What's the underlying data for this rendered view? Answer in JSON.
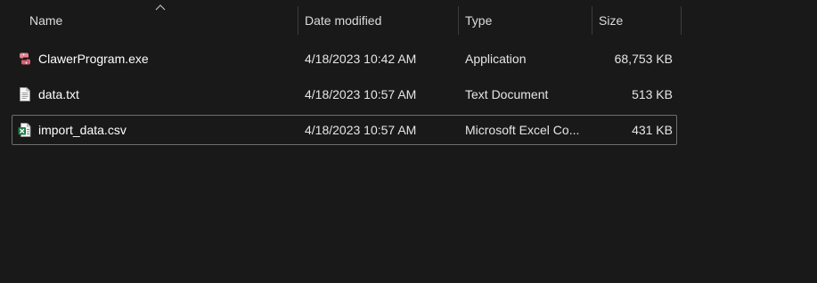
{
  "columns": {
    "name": "Name",
    "date_modified": "Date modified",
    "type": "Type",
    "size": "Size",
    "sorted_by": "name",
    "sort_direction": "ascending"
  },
  "files": [
    {
      "name": "ClawerProgram.exe",
      "date_modified": "4/18/2023 10:42 AM",
      "type": "Application",
      "size": "68,753 KB",
      "icon": "python-exe-icon",
      "selected": false
    },
    {
      "name": "data.txt",
      "date_modified": "4/18/2023 10:57 AM",
      "type": "Text Document",
      "size": "513 KB",
      "icon": "text-document-icon",
      "selected": false
    },
    {
      "name": "import_data.csv",
      "date_modified": "4/18/2023 10:57 AM",
      "type": "Microsoft Excel Co...",
      "size": "431 KB",
      "icon": "excel-csv-icon",
      "selected": true
    }
  ],
  "colors": {
    "background": "#191919",
    "selection_border": "#6e6e6e",
    "excel_green": "#1d7a45"
  }
}
